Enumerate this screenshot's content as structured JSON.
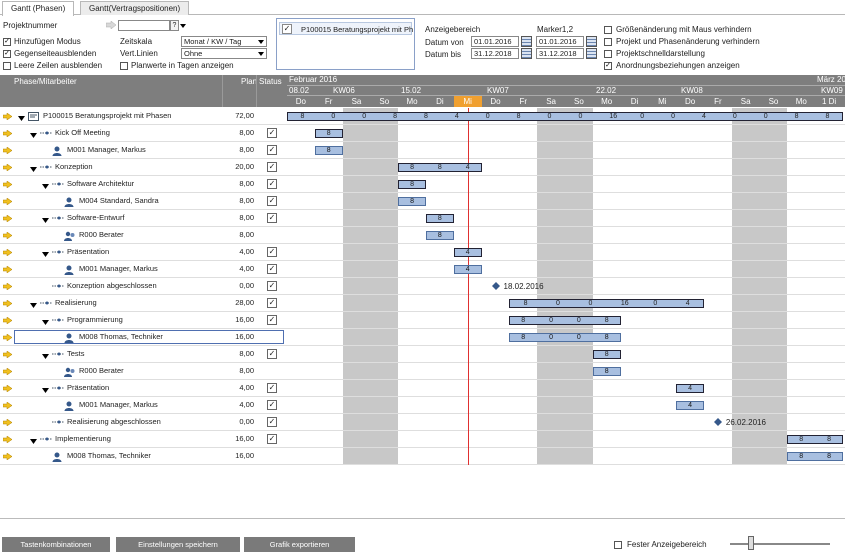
{
  "tabs": [
    {
      "label": "Gantt (Phasen)",
      "active": true
    },
    {
      "label": "Gantt(Vertragspositionen)",
      "active": false
    }
  ],
  "controls": {
    "projektnummer_label": "Projektnummer",
    "hinzufuegen_label": "Hinzufügen Modus",
    "gegenseite_label": "Gegenseiteausblenden",
    "leere_zeilen_label": "Leere Zeilen ausblenden",
    "zeitskala_label": "Zeitskala",
    "zeitskala_value": "Monat / KW / Tag",
    "vertlinien_label": "Vert.Linien",
    "vertlinien_value": "Ohne",
    "planwerte_label": "Planwerte in Tagen  anzeigen",
    "project_list_item": "P100015 Beratungsprojekt mit Ph",
    "anzeigebereich_label": "Anzeigebereich",
    "marker_label": "Marker1,2",
    "datum_von_label": "Datum von",
    "datum_bis_label": "Datum bis",
    "datum_von": "01.01.2016",
    "datum_bis": "31.12.2018",
    "marker1": "01.01.2016",
    "marker2": "31.12.2018",
    "opt1": "Größenänderung mit Maus verhindern",
    "opt2": "Projekt und Phasenänderung verhindern",
    "opt3": "Projektschnelldarstellung",
    "opt4": "Anordnungsbeziehungen anzeigen"
  },
  "grid_header": {
    "col_phase": "Phase/Mitarbeiter",
    "col_plan": "Plan",
    "col_status": "Status",
    "months": [
      {
        "label": "Februar 2016",
        "offset": 0
      },
      {
        "label": "März 20",
        "offset": 0
      }
    ],
    "weeks": [
      {
        "date": "08.02",
        "kw": "KW06"
      },
      {
        "date": "15.02",
        "kw": "KW07"
      },
      {
        "date": "22.02",
        "kw": "KW08"
      },
      {
        "kw": "KW09"
      }
    ],
    "days": [
      "Do",
      "Fr",
      "Sa",
      "So",
      "Mo",
      "Di",
      "Mi",
      "Do",
      "Fr",
      "Sa",
      "So",
      "Mo",
      "Di",
      "Mi",
      "Do",
      "Fr",
      "Sa",
      "So",
      "Mo",
      "1 Di"
    ],
    "today_index": 6
  },
  "rows": [
    {
      "name": "P100015  Beratungsprojekt mit Phasen",
      "plan": "72,00",
      "status": false,
      "level": 0,
      "kind": "project"
    },
    {
      "name": "Kick Off Meeting",
      "plan": "8,00",
      "status": true,
      "level": 1,
      "kind": "phase"
    },
    {
      "name": "M001 Manager, Markus",
      "plan": "8,00",
      "status": true,
      "level": 2,
      "kind": "person"
    },
    {
      "name": "Konzeption",
      "plan": "20,00",
      "status": true,
      "level": 1,
      "kind": "phase"
    },
    {
      "name": "Software Architektur",
      "plan": "8,00",
      "status": true,
      "level": 2,
      "kind": "phase"
    },
    {
      "name": "M004 Standard, Sandra",
      "plan": "8,00",
      "status": true,
      "level": 3,
      "kind": "person"
    },
    {
      "name": "Software-Entwurf",
      "plan": "8,00",
      "status": true,
      "level": 2,
      "kind": "phase"
    },
    {
      "name": "R000 Berater",
      "plan": "8,00",
      "status": false,
      "level": 3,
      "kind": "group"
    },
    {
      "name": "Präsentation",
      "plan": "4,00",
      "status": true,
      "level": 2,
      "kind": "phase"
    },
    {
      "name": "M001 Manager, Markus",
      "plan": "4,00",
      "status": true,
      "level": 3,
      "kind": "person"
    },
    {
      "name": "Konzeption abgeschlossen",
      "plan": "0,00",
      "status": true,
      "level": 2,
      "kind": "milestone"
    },
    {
      "name": "Realisierung",
      "plan": "28,00",
      "status": true,
      "level": 1,
      "kind": "phase"
    },
    {
      "name": "Programmierung",
      "plan": "16,00",
      "status": true,
      "level": 2,
      "kind": "phase"
    },
    {
      "name": "M008 Thomas, Techniker",
      "plan": "16,00",
      "status": false,
      "level": 3,
      "kind": "person",
      "selected": true
    },
    {
      "name": "Tests",
      "plan": "8,00",
      "status": true,
      "level": 2,
      "kind": "phase"
    },
    {
      "name": "R000 Berater",
      "plan": "8,00",
      "status": false,
      "level": 3,
      "kind": "group"
    },
    {
      "name": "Präsentation",
      "plan": "4,00",
      "status": true,
      "level": 2,
      "kind": "phase"
    },
    {
      "name": "M001 Manager, Markus",
      "plan": "4,00",
      "status": true,
      "level": 3,
      "kind": "person"
    },
    {
      "name": "Realisierung abgeschlossen",
      "plan": "0,00",
      "status": true,
      "level": 2,
      "kind": "milestone"
    },
    {
      "name": "Implementierung",
      "plan": "16,00",
      "status": true,
      "level": 1,
      "kind": "phase"
    },
    {
      "name": "M008 Thomas, Techniker",
      "plan": "16,00",
      "status": false,
      "level": 2,
      "kind": "person"
    }
  ],
  "bars": [
    {
      "row": 0,
      "type": "summary",
      "start": 0,
      "end": 20,
      "labels": [
        "8",
        "0",
        "0",
        "8",
        "8",
        "4",
        "0",
        "8",
        "0",
        "0",
        "16",
        "0",
        "0",
        "4",
        "0",
        "0",
        "8",
        "8"
      ]
    },
    {
      "row": 1,
      "type": "summary",
      "start": 1,
      "end": 2,
      "labels": [
        "8"
      ]
    },
    {
      "row": 2,
      "type": "bar",
      "start": 1,
      "end": 2,
      "labels": [
        "8"
      ]
    },
    {
      "row": 3,
      "type": "summary",
      "start": 4,
      "end": 7,
      "labels": [
        "8",
        "8",
        "4"
      ]
    },
    {
      "row": 4,
      "type": "summary",
      "start": 4,
      "end": 5,
      "labels": [
        "8"
      ]
    },
    {
      "row": 5,
      "type": "bar",
      "start": 4,
      "end": 5,
      "labels": [
        "8"
      ]
    },
    {
      "row": 6,
      "type": "summary",
      "start": 5,
      "end": 6,
      "labels": [
        "8"
      ]
    },
    {
      "row": 7,
      "type": "bar",
      "start": 5,
      "end": 6,
      "labels": [
        "8"
      ]
    },
    {
      "row": 8,
      "type": "summary",
      "start": 6,
      "end": 7,
      "labels": [
        "4"
      ]
    },
    {
      "row": 9,
      "type": "bar",
      "start": 6,
      "end": 7,
      "labels": [
        "4"
      ]
    },
    {
      "row": 11,
      "type": "summary",
      "start": 8,
      "end": 15,
      "labels": [
        "8",
        "0",
        "0",
        "16",
        "0",
        "4"
      ]
    },
    {
      "row": 12,
      "type": "summary",
      "start": 8,
      "end": 12,
      "labels": [
        "8",
        "0",
        "0",
        "8"
      ]
    },
    {
      "row": 13,
      "type": "bar",
      "start": 8,
      "end": 12,
      "labels": [
        "8",
        "0",
        "0",
        "8"
      ]
    },
    {
      "row": 14,
      "type": "summary",
      "start": 11,
      "end": 12,
      "labels": [
        "8"
      ]
    },
    {
      "row": 15,
      "type": "bar",
      "start": 11,
      "end": 12,
      "labels": [
        "8"
      ]
    },
    {
      "row": 16,
      "type": "summary",
      "start": 14,
      "end": 15,
      "labels": [
        "4"
      ]
    },
    {
      "row": 17,
      "type": "bar",
      "start": 14,
      "end": 15,
      "labels": [
        "4"
      ]
    },
    {
      "row": 19,
      "type": "summary",
      "start": 18,
      "end": 20,
      "labels": [
        "8",
        "8"
      ]
    },
    {
      "row": 20,
      "type": "bar",
      "start": 18,
      "end": 20,
      "labels": [
        "8",
        "8"
      ]
    }
  ],
  "milestones": [
    {
      "row": 10,
      "day": 7.5,
      "label": "18.02.2016"
    },
    {
      "row": 18,
      "day": 15.5,
      "label": "26.02.2016"
    }
  ],
  "footer": {
    "btn_tasten": "Tastenkombinationen",
    "btn_einstellungen": "Einstellungen speichern",
    "btn_grafik": "Grafik exportieren",
    "fester_label": "Fester Anzeigebereich"
  },
  "colors": {
    "accent": "#f0a030",
    "bar": "#a8bfe0",
    "today_line": "#e03030"
  }
}
